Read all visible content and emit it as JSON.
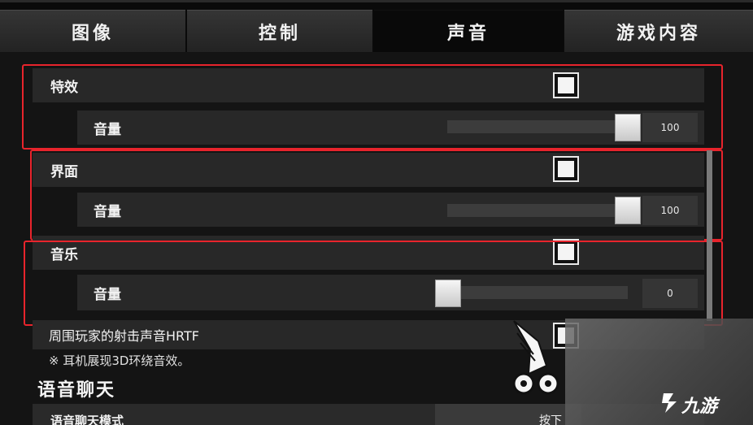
{
  "tabs": [
    {
      "label": "图像",
      "active": false
    },
    {
      "label": "控制",
      "active": false
    },
    {
      "label": "声音",
      "active": true
    },
    {
      "label": "游戏内容",
      "active": false
    }
  ],
  "groups": [
    {
      "label": "特效",
      "checked": true,
      "volume_label": "音量",
      "volume": 100,
      "volume_text": "100"
    },
    {
      "label": "界面",
      "checked": true,
      "volume_label": "音量",
      "volume": 100,
      "volume_text": "100"
    },
    {
      "label": "音乐",
      "checked": true,
      "volume_label": "音量",
      "volume": 0,
      "volume_text": "0"
    }
  ],
  "hrtf": {
    "label": "周围玩家的射击声音HRTF",
    "note": "※ 耳机展现3D环绕音效。"
  },
  "voice_chat": {
    "title": "语音聊天",
    "mode_label": "语音聊天模式",
    "mode_value": "按下"
  },
  "watermark": {
    "text": "九游"
  },
  "colors": {
    "highlight": "#e8242c",
    "row_bg": "#282828",
    "active_tab": "#090909"
  }
}
